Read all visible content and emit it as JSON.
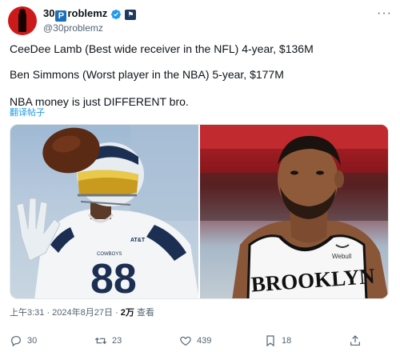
{
  "author": {
    "name_prefix": "30",
    "name_box": "P",
    "name_suffix": "roblemz",
    "handle": "@30problemz",
    "affiliate_badge": "⚑"
  },
  "tweet": {
    "line1": "CeeDee Lamb (Best wide receiver in the NFL) 4-year, $136M",
    "line2": "Ben Simmons (Worst player in the NBA) 5-year, $177M",
    "line3": "NBA money is just DIFFERENT bro.",
    "translate_label": "翻译帖子"
  },
  "media": {
    "left_jersey_number": "88",
    "left_jersey_text": "COWBOYS",
    "left_sponsor": "AT&T",
    "right_jersey_text": "BROOKLYN",
    "right_sponsor": "Webull"
  },
  "meta": {
    "time": "上午3:31 · 2024年8月27日 · ",
    "views_count": "2万",
    "views_label": " 查看"
  },
  "actions": {
    "replies": "30",
    "reposts": "23",
    "likes": "439",
    "bookmarks": "18"
  },
  "colors": {
    "accent": "#1d9bf0",
    "muted": "#536471",
    "text": "#0f1419"
  }
}
